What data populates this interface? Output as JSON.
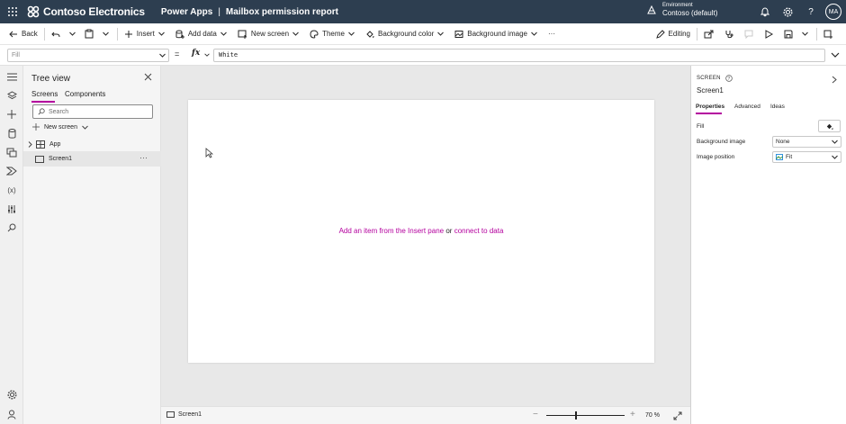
{
  "header": {
    "brand": "Contoso Electronics",
    "app_name": "Power Apps",
    "separator": "|",
    "document_title": "Mailbox permission report",
    "environment_label": "Environment",
    "environment_value": "Contoso (default)",
    "avatar_initials": "MA",
    "background_color": "#2d3e50"
  },
  "commandbar": {
    "back": "Back",
    "insert": "Insert",
    "add_data": "Add data",
    "new_screen": "New screen",
    "theme": "Theme",
    "background_color": "Background color",
    "background_image": "Background image",
    "more": "···",
    "editing": "Editing"
  },
  "formulabar": {
    "property": "Fill",
    "equals": "=",
    "fx": "fx",
    "formula": "White"
  },
  "tree": {
    "title": "Tree view",
    "tabs": [
      "Screens",
      "Components"
    ],
    "search_placeholder": "Search",
    "new_screen": "New screen",
    "items": [
      {
        "label": "App"
      },
      {
        "label": "Screen1",
        "more": "···"
      }
    ]
  },
  "canvas": {
    "hint_part1": "Add an item from the Insert pane",
    "hint_or": "or",
    "hint_part2": "connect to data",
    "accent_color": "#b4009e"
  },
  "statusbar": {
    "screen_name": "Screen1",
    "zoom_minus": "−",
    "zoom_plus": "+",
    "zoom_value": "70  %",
    "zoom_level_percent": 70
  },
  "properties": {
    "kind": "SCREEN",
    "name": "Screen1",
    "tabs": [
      "Properties",
      "Advanced",
      "Ideas"
    ],
    "rows": [
      {
        "label": "Fill"
      },
      {
        "label": "Background image",
        "value": "None"
      },
      {
        "label": "Image position",
        "value": "Fit"
      }
    ]
  }
}
